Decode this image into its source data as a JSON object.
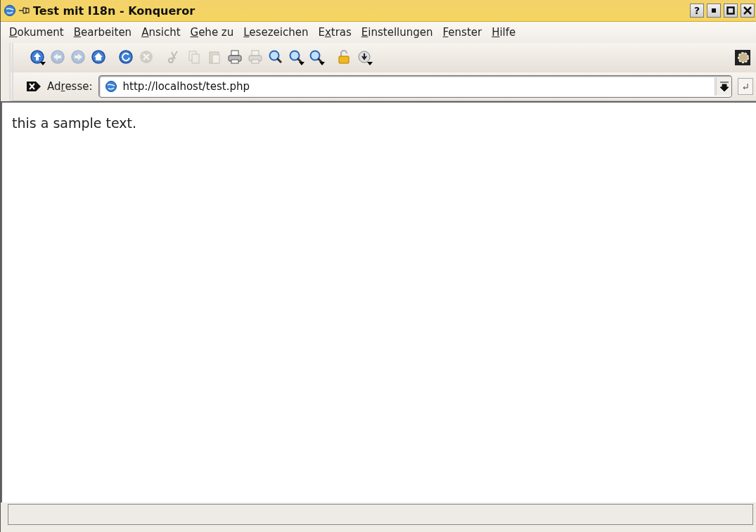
{
  "window": {
    "title": "Test mit I18n - Konqueror",
    "buttons": [
      {
        "kind": "help",
        "label": "?"
      },
      {
        "kind": "minimize"
      },
      {
        "kind": "maximize"
      },
      {
        "kind": "close"
      }
    ]
  },
  "menu": [
    {
      "key": "D",
      "after": "okument"
    },
    {
      "key": "B",
      "after": "earbeiten"
    },
    {
      "key": "A",
      "after": "nsicht"
    },
    {
      "key": "G",
      "after": "ehe zu"
    },
    {
      "key": "L",
      "after": "esezeichen"
    },
    {
      "before": "E",
      "key": "x",
      "after": "tras"
    },
    {
      "key": "E",
      "after": "instellungen"
    },
    {
      "key": "F",
      "after": "enster"
    },
    {
      "key": "H",
      "after": "ilfe"
    }
  ],
  "toolbar": [
    {
      "kind": "up",
      "disabled": false,
      "menu": true
    },
    {
      "kind": "back",
      "disabled": true,
      "menu": false
    },
    {
      "kind": "forward",
      "disabled": true,
      "menu": false
    },
    {
      "kind": "home",
      "disabled": false,
      "menu": false
    },
    {
      "kind": "reload",
      "disabled": false,
      "menu": false
    },
    {
      "kind": "stop",
      "disabled": true,
      "menu": false
    },
    {
      "kind": "cut",
      "disabled": true,
      "menu": false
    },
    {
      "kind": "copy",
      "disabled": true,
      "menu": false
    },
    {
      "kind": "paste",
      "disabled": true,
      "menu": false
    },
    {
      "kind": "print",
      "disabled": false,
      "menu": false
    },
    {
      "kind": "print",
      "disabled": true,
      "menu": false
    },
    {
      "kind": "zoom",
      "disabled": false,
      "menu": false
    },
    {
      "kind": "zoom",
      "disabled": false,
      "menu": true
    },
    {
      "kind": "zoom",
      "disabled": false,
      "menu": true
    },
    {
      "kind": "lock",
      "disabled": false,
      "menu": false
    },
    {
      "kind": "download",
      "disabled": false,
      "menu": true
    }
  ],
  "address": {
    "label": {
      "before": "Ad",
      "key": "r",
      "after": "esse:"
    },
    "value": "http://localhost/test.php"
  },
  "content": {
    "text": "this a sample text."
  }
}
